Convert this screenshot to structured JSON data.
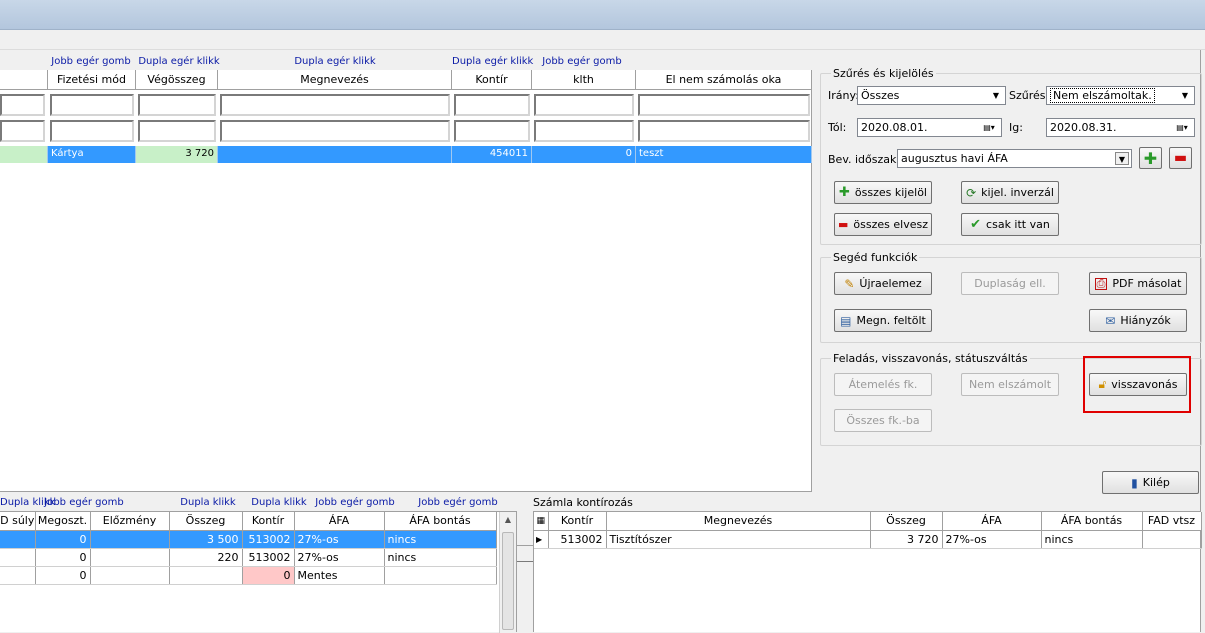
{
  "top_hints": [
    "Jobb egér gomb",
    "Dupla egér klikk",
    "Dupla egér klikk",
    "Dupla egér klikk",
    "Jobb egér gomb"
  ],
  "main_grid": {
    "columns": [
      "Fizetési mód",
      "Végösszeg",
      "Megnevezés",
      "Kontír",
      "klth",
      "El nem számolás oka"
    ],
    "row": {
      "fizetesi_mod": "Kártya",
      "vegosszeg": "3 720",
      "megnevezes": "",
      "kontir": "454011",
      "klth": "0",
      "ok": "teszt"
    }
  },
  "filter": {
    "group_label": "Szűrés és kijelölés",
    "irany_label": "Irány:",
    "irany_value": "Összes",
    "szures_label": "Szűrés:",
    "szures_value": "Nem elszámoltak.",
    "tol_label": "Tól:",
    "tol_value": "2020.08.01.",
    "ig_label": "Ig:",
    "ig_value": "2020.08.31.",
    "bev_label": "Bev. időszak:",
    "bev_value": "augusztus havi ÁFA",
    "btn_osszes_kijelol": "összes kijelöl",
    "btn_kijel_inverzal": "kijel. inverzál",
    "btn_osszes_elvesz": "összes elvesz",
    "btn_csak_itt_van": "csak itt van"
  },
  "seged": {
    "group_label": "Segéd funkciók",
    "btn_ujraelemez": "Újraelemez",
    "btn_duplasag": "Duplaság ell.",
    "btn_pdf": "PDF másolat",
    "btn_megn_feltolt": "Megn. feltölt",
    "btn_hianyzok": "Hiányzók"
  },
  "feladas": {
    "group_label": "Feladás, visszavonás, státuszváltás",
    "btn_atemeles": "Átemelés fk.",
    "btn_nem_elszamolt": "Nem elszámolt",
    "btn_visszavonas": "visszavonás",
    "btn_osszes_fk": "Összes fk.-ba"
  },
  "btn_kilep": "Kilép",
  "bottom_hints": [
    "Dupla klikk",
    "Jobb egér gomb",
    "Dupla klikk",
    "Dupla klikk",
    "Jobb egér gomb",
    "Jobb egér gomb"
  ],
  "left_table": {
    "columns": [
      "D súly",
      "Megoszt.",
      "Előzmény",
      "Összeg",
      "Kontír",
      "ÁFA",
      "ÁFA bontás"
    ],
    "rows": [
      [
        "",
        "0",
        "",
        "3 500",
        "513002",
        "27%-os",
        "nincs"
      ],
      [
        "",
        "0",
        "",
        "220",
        "513002",
        "27%-os",
        "nincs"
      ],
      [
        "",
        "0",
        "",
        "",
        "0",
        "Mentes",
        ""
      ]
    ]
  },
  "szamla_label": "Számla kontírozás",
  "right_table": {
    "columns": [
      "Kontír",
      "Megnevezés",
      "Összeg",
      "ÁFA",
      "ÁFA bontás",
      "FAD vtsz"
    ],
    "rows": [
      [
        "513002",
        "Tisztítószer",
        "3 720",
        "27%-os",
        "nincs",
        ""
      ]
    ]
  },
  "colors": {
    "selection": "#3399ff",
    "highlight_red": "#e00000",
    "green_cell": "#c8f0c8",
    "pink_cell": "#ffc8c8"
  }
}
